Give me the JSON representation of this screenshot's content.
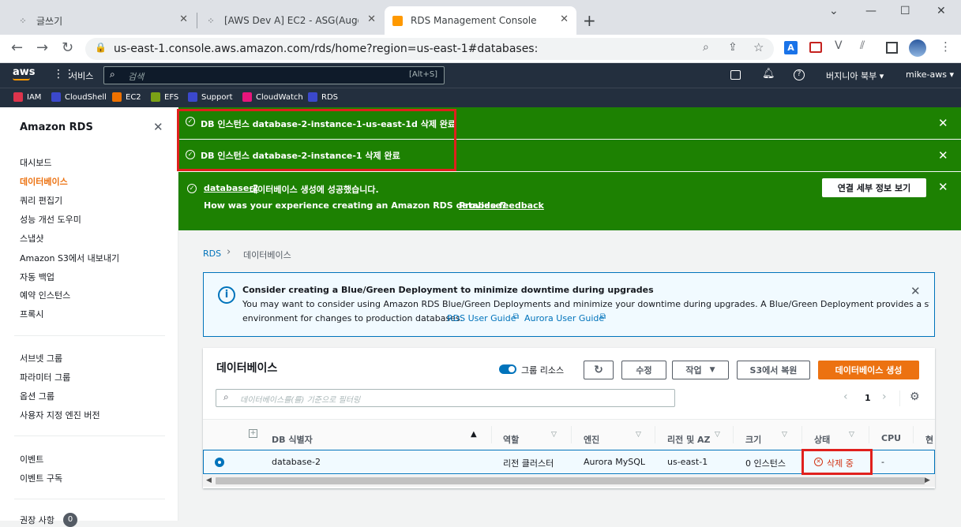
{
  "browser": {
    "tabs": [
      {
        "title": "글쓰기",
        "icon": "tistory-icon"
      },
      {
        "title": "[AWS Dev A] EC2 - ASG(Augo S",
        "icon": "tistory-icon"
      },
      {
        "title": "RDS Management Console",
        "icon": "aws-icon"
      }
    ],
    "url": "us-east-1.console.aws.amazon.com/rds/home?region=us-east-1#databases:"
  },
  "awsnav": {
    "logo": "aws",
    "services": "서비스",
    "search_placeholder": "검색",
    "search_shortcut": "[Alt+S]",
    "region": "버지니아 북부 ▾",
    "user": "mike-aws ▾"
  },
  "bookmarks": [
    {
      "label": "IAM",
      "color": "#dd344c"
    },
    {
      "label": "CloudShell",
      "color": "#3b48cc"
    },
    {
      "label": "EC2",
      "color": "#ed7100"
    },
    {
      "label": "EFS",
      "color": "#7aa116"
    },
    {
      "label": "Support",
      "color": "#3b48cc"
    },
    {
      "label": "CloudWatch",
      "color": "#e7157b"
    },
    {
      "label": "RDS",
      "color": "#3b48cc"
    }
  ],
  "sidebar": {
    "title": "Amazon RDS",
    "items": [
      "대시보드",
      "데이터베이스",
      "쿼리 편집기",
      "성능 개선 도우미",
      "스냅샷",
      "Amazon S3에서 내보내기",
      "자동 백업",
      "예약 인스턴스",
      "프록시"
    ],
    "items2": [
      "서브넷 그룹",
      "파라미터 그룹",
      "옵션 그룹",
      "사용자 지정 엔진 버전"
    ],
    "items3": [
      "이벤트",
      "이벤트 구독"
    ],
    "items4": [
      "권장 사항"
    ],
    "badge": "0"
  },
  "flash": {
    "msg1": "DB 인스턴스 database-2-instance-1-us-east-1d 삭제 완료",
    "msg2": "DB 인스턴스 database-2-instance-1 삭제 완료",
    "msg3_link": "database-2",
    "msg3_text": " 데이터베이스 생성에 성공했습니다.",
    "feedback_q": "How was your experience creating an Amazon RDS database? ",
    "feedback_link": "Provide feedback",
    "details_button": "연결 세부 정보 보기",
    "color": "#1d8102"
  },
  "breadcrumb": {
    "root": "RDS",
    "current": "데이터베이스"
  },
  "info": {
    "title": "Consider creating a Blue/Green Deployment to minimize downtime during upgrades",
    "body1": "You may want to consider using Amazon RDS Blue/Green Deployments and minimize your downtime during upgrades. A Blue/Green Deployment provides a staging",
    "body2": "environment for changes to production databases. ",
    "link1": "RDS User Guide",
    "link2": "Aurora User Guide"
  },
  "panel": {
    "title": "데이터베이스",
    "group_toggle": "그룹 리소스",
    "modify": "수정",
    "actions": "작업",
    "restore": "S3에서 복원",
    "create": "데이터베이스 생성",
    "filter_placeholder": "데이터베이스를(를) 기준으로 필터링",
    "page": "1",
    "columns": [
      "DB 식별자",
      "역할",
      "엔진",
      "리전 및 AZ",
      "크기",
      "상태",
      "CPU",
      "현"
    ],
    "row": {
      "id": "database-2",
      "role": "리전 클러스터",
      "engine": "Aurora MySQL",
      "region": "us-east-1",
      "size": "0 인스턴스",
      "status": "삭제 중",
      "cpu": "-"
    },
    "accent": "#ec7211"
  },
  "status_color": "#d13212"
}
